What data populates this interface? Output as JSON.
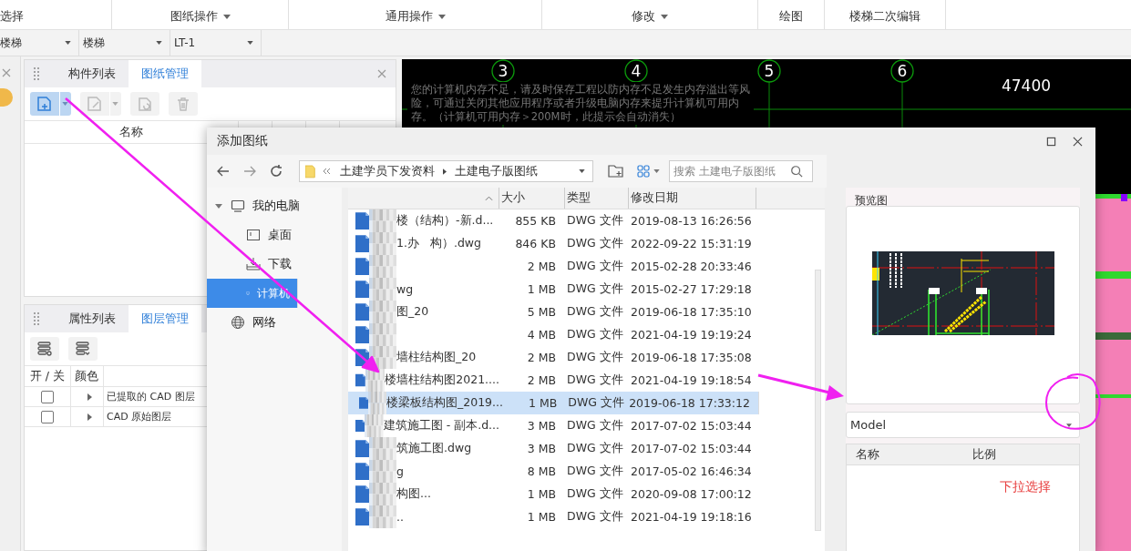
{
  "ribbon": {
    "groups": [
      {
        "label": "选择",
        "dropdown": false
      },
      {
        "label": "图纸操作",
        "dropdown": true
      },
      {
        "label": "通用操作",
        "dropdown": true
      },
      {
        "label": "修改",
        "dropdown": true
      },
      {
        "label": "绘图",
        "dropdown": false
      },
      {
        "label": "楼梯二次编辑",
        "dropdown": false
      }
    ]
  },
  "selectors": [
    "楼梯",
    "楼梯",
    "LT-1"
  ],
  "drawing_panel": {
    "tabs": [
      {
        "label": "构件列表",
        "selected": false
      },
      {
        "label": "图纸管理",
        "selected": true
      }
    ],
    "columns": [
      "名称"
    ]
  },
  "layer_panel": {
    "tabs": [
      {
        "label": "属性列表",
        "selected": false
      },
      {
        "label": "图层管理",
        "selected": true
      }
    ],
    "columns": [
      "开 / 关",
      "颜色"
    ],
    "rows": [
      {
        "checked": false,
        "name": "已提取的 CAD 图层"
      },
      {
        "checked": false,
        "name": "CAD 原始图层"
      }
    ]
  },
  "canvas": {
    "notice": "您的计算机内存不足，请及时保存工程以防内存不足发生内存溢出等风险，可通过关闭其他应用程序或者升级电脑内存来提升计算机可用内存。（计算机可用内存＞200M时，此提示会自动消失）",
    "axes": [
      "3",
      "4",
      "5",
      "6"
    ],
    "dimension": "47400"
  },
  "dialog": {
    "title": "添加图纸",
    "path": [
      "土建学员下发资料",
      "土建电子版图纸"
    ],
    "search": {
      "placeholder": "搜索 土建电子版图纸"
    },
    "tree": [
      {
        "label": "我的电脑",
        "kind": "pc",
        "expanded": true,
        "selected": false,
        "children": [
          {
            "label": "桌面",
            "kind": "desktop",
            "selected": false
          },
          {
            "label": "下载",
            "kind": "download",
            "selected": false
          },
          {
            "label": "计算机",
            "kind": "pc",
            "selected": true
          }
        ]
      },
      {
        "label": "网络",
        "kind": "globe",
        "selected": false
      }
    ],
    "columns": [
      "大小",
      "类型",
      "修改日期"
    ],
    "files": [
      {
        "name": "楼（结构）-新.d...",
        "size": "855 KB",
        "type": "DWG 文件",
        "modified": "2019-08-13 16:26:56",
        "selected": false
      },
      {
        "prefix": "1.办",
        "name": "构）.dwg",
        "size": "846 KB",
        "type": "DWG 文件",
        "modified": "2022-09-22 15:31:19",
        "selected": false
      },
      {
        "size": "2 MB",
        "type": "DWG 文件",
        "modified": "2015-02-28 20:33:46",
        "selected": false
      },
      {
        "name": "wg",
        "size": "1 MB",
        "type": "DWG 文件",
        "modified": "2015-02-27 17:29:18",
        "selected": false
      },
      {
        "name": "图_20",
        "size": "5 MB",
        "type": "DWG 文件",
        "modified": "2019-06-18 17:35:10",
        "selected": false
      },
      {
        "size": "4 MB",
        "type": "DWG 文件",
        "modified": "2021-04-19 19:19:24",
        "selected": false
      },
      {
        "name": "墙柱结构图_20",
        "size": "2 MB",
        "type": "DWG 文件",
        "modified": "2019-06-18 17:35:08",
        "selected": false
      },
      {
        "name": "楼墙柱结构图2021....",
        "size": "2 MB",
        "type": "DWG 文件",
        "modified": "2021-04-19 19:18:54",
        "selected": false
      },
      {
        "name": "楼梁板结构图_2019...",
        "size": "1 MB",
        "type": "DWG 文件",
        "modified": "2019-06-18 17:33:12",
        "selected": true
      },
      {
        "name": "建筑施工图 - 副本.d...",
        "size": "3 MB",
        "type": "DWG 文件",
        "modified": "2017-07-02 15:03:44",
        "selected": false
      },
      {
        "name": "筑施工图.dwg",
        "size": "3 MB",
        "type": "DWG 文件",
        "modified": "2017-07-02 15:03:44",
        "selected": false
      },
      {
        "name": "g",
        "size": "8 MB",
        "type": "DWG 文件",
        "modified": "2017-05-02 16:46:34",
        "selected": false
      },
      {
        "name": "构图...",
        "size": "1 MB",
        "type": "DWG 文件",
        "modified": "2020-09-08 17:00:12",
        "selected": false
      },
      {
        "name": "..",
        "size": "1 MB",
        "type": "DWG 文件",
        "modified": "2021-04-19 19:18:16",
        "selected": false
      }
    ],
    "preview": {
      "title": "预览图"
    },
    "layout_select": {
      "value": "Model"
    },
    "layout_columns": [
      "名称",
      "比例"
    ],
    "note": "下拉选择"
  }
}
